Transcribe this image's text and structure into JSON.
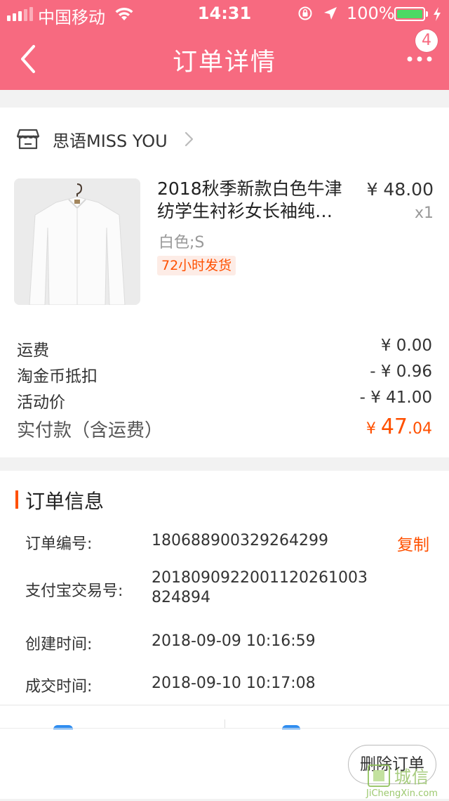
{
  "status": {
    "carrier": "中国移动",
    "time": "14:31",
    "battery": "100%",
    "battery_level": 1.0
  },
  "nav": {
    "title": "订单详情",
    "badge": "4",
    "color": "#f76a80"
  },
  "shop": {
    "name": "思语MISS YOU"
  },
  "product": {
    "title": "2018秋季新款白色牛津纺学生衬衫女长袖纯…",
    "price": "¥ 48.00",
    "qty": "x1",
    "sku": "白色;S",
    "tag": "72小时发货"
  },
  "fees": [
    {
      "label": "运费",
      "value": "¥ 0.00"
    },
    {
      "label": "淘金币抵扣",
      "value": "- ¥ 0.96"
    },
    {
      "label": "活动价",
      "value": "- ¥ 41.00"
    }
  ],
  "payment": {
    "label": "实付款（含运费）",
    "currency": "¥ ",
    "integer": "47",
    "decimal": ".04",
    "color": "#ff5000"
  },
  "order_info": {
    "title": "订单信息",
    "copy_label": "复制",
    "rows": [
      {
        "key": "订单编号:",
        "value": "180688900329264299"
      },
      {
        "key": "支付宝交易号:",
        "value": "2018090922001120261003824894"
      },
      {
        "key": "创建时间:",
        "value": "2018-09-09 10:16:59"
      },
      {
        "key": "成交时间:",
        "value": "2018-09-10 10:17:08"
      }
    ]
  },
  "actions": {
    "delete_label": "删除订单"
  },
  "watermark": {
    "main": "城信",
    "sub": "JiChengXin.com"
  }
}
